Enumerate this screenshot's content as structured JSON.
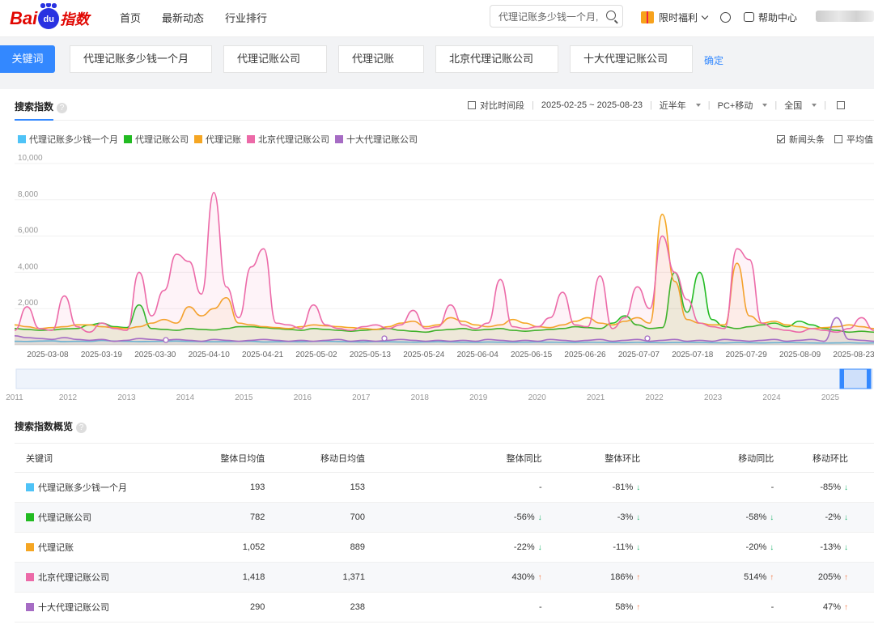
{
  "header": {
    "logo": {
      "bai": "Bai",
      "du": "du",
      "zhishu": "指数"
    },
    "nav": [
      "首页",
      "最新动态",
      "行业排行"
    ],
    "search_value": "代理记账多少钱一个月,",
    "welfare": "限时福利",
    "help": "帮助中心"
  },
  "keywords": {
    "label": "关键词",
    "items": [
      {
        "text": "代理记账多少钱一个月",
        "color": "#4fc3f7"
      },
      {
        "text": "代理记账公司",
        "color": "#22bb22"
      },
      {
        "text": "代理记账",
        "color": "#f5a623"
      },
      {
        "text": "北京代理记账公司",
        "color": "#ec6aa8"
      },
      {
        "text": "十大代理记账公司",
        "color": "#a66cc4"
      }
    ],
    "confirm": "确定"
  },
  "section": {
    "title": "搜索指数",
    "compare": "对比时间段",
    "date_range": "2025-02-25 ~ 2025-08-23",
    "period": "近半年",
    "device": "PC+移动",
    "region": "全国",
    "news": "新闻头条",
    "average": "平均值"
  },
  "chart_data": {
    "type": "line",
    "y_ticks": [
      "10,000",
      "8,000",
      "6,000",
      "4,000",
      "2,000"
    ],
    "ylim": [
      0,
      10000
    ],
    "x_ticks": [
      "2025-03-08",
      "2025-03-19",
      "2025-03-30",
      "2025-04-10",
      "2025-04-21",
      "2025-05-02",
      "2025-05-13",
      "2025-05-24",
      "2025-06-04",
      "2025-06-15",
      "2025-06-26",
      "2025-07-07",
      "2025-07-18",
      "2025-07-29",
      "2025-08-09",
      "2025-08-23"
    ],
    "series": [
      {
        "name": "代理记账多少钱一个月",
        "color": "#4fc3f7",
        "values": [
          200,
          190,
          210,
          220,
          180,
          200,
          190,
          240,
          210,
          200,
          180,
          190,
          200,
          210,
          190,
          180,
          170,
          180,
          190,
          200,
          160,
          170,
          180,
          170,
          190,
          200,
          180,
          170,
          160,
          180,
          170,
          160,
          150,
          160,
          170,
          160,
          150,
          140,
          160,
          150,
          140,
          150,
          160,
          150,
          140,
          130,
          150,
          140,
          130,
          120,
          140,
          130,
          120,
          130,
          140,
          130,
          120,
          110,
          130,
          120,
          110,
          120,
          130,
          120,
          110,
          100,
          110,
          120,
          100,
          110
        ]
      },
      {
        "name": "代理记账公司",
        "color": "#22bb22",
        "values": [
          900,
          850,
          800,
          820,
          880,
          900,
          1100,
          1200,
          1000,
          950,
          2200,
          900,
          850,
          800,
          900,
          850,
          820,
          900,
          1000,
          1000,
          950,
          900,
          850,
          800,
          900,
          850,
          800,
          750,
          800,
          850,
          900,
          800,
          750,
          700,
          800,
          850,
          900,
          800,
          850,
          900,
          800,
          750,
          800,
          850,
          900,
          1000,
          950,
          900,
          1200,
          1600,
          1100,
          900,
          950,
          4000,
          1800,
          4000,
          1400,
          1000,
          900,
          1000,
          1100,
          1200,
          1000,
          1300,
          1100,
          900,
          800,
          700,
          750,
          700
        ]
      },
      {
        "name": "代理记账",
        "color": "#f5a623",
        "values": [
          1100,
          1000,
          900,
          950,
          1000,
          1100,
          1100,
          1000,
          950,
          900,
          1000,
          1200,
          1400,
          1200,
          2100,
          1600,
          2000,
          2600,
          1200,
          1100,
          1000,
          950,
          900,
          1000,
          1100,
          1050,
          1000,
          950,
          900,
          850,
          1000,
          1200,
          1300,
          1000,
          1100,
          1500,
          1300,
          1100,
          1000,
          1100,
          1400,
          1200,
          1000,
          950,
          1100,
          1300,
          1500,
          1200,
          1100,
          1300,
          1500,
          1200,
          7200,
          3500,
          1400,
          1200,
          1100,
          1100,
          4500,
          1600,
          1200,
          1300,
          1100,
          1000,
          900,
          950,
          1000,
          1100,
          1000,
          900
        ]
      },
      {
        "name": "北京代理记账公司",
        "color": "#ec6aa8",
        "values": [
          800,
          2100,
          900,
          800,
          2700,
          1000,
          700,
          1200,
          900,
          800,
          4000,
          1600,
          3000,
          5000,
          4600,
          2800,
          8400,
          3200,
          1500,
          4300,
          5300,
          1200,
          1100,
          900,
          2200,
          1100,
          900,
          800,
          1000,
          1100,
          900,
          1100,
          1900,
          900,
          1000,
          2200,
          1100,
          900,
          1200,
          3600,
          1000,
          900,
          1000,
          1500,
          2900,
          1100,
          1000,
          3800,
          900,
          1500,
          3200,
          2000,
          6000,
          4000,
          2500,
          1200,
          1000,
          900,
          5300,
          4700,
          1200,
          900,
          800,
          700,
          900,
          800,
          700,
          900,
          1500,
          800
        ]
      },
      {
        "name": "十大代理记账公司",
        "color": "#a66cc4",
        "values": [
          500,
          400,
          350,
          300,
          400,
          300,
          250,
          300,
          200,
          250,
          350,
          300,
          250,
          300,
          250,
          200,
          300,
          250,
          200,
          250,
          300,
          250,
          200,
          250,
          200,
          250,
          300,
          200,
          250,
          200,
          250,
          300,
          250,
          200,
          250,
          200,
          250,
          200,
          300,
          250,
          200,
          250,
          200,
          300,
          250,
          200,
          250,
          300,
          200,
          250,
          300,
          200,
          250,
          300,
          200,
          250,
          200,
          300,
          250,
          200,
          250,
          300,
          200,
          250,
          300,
          200,
          1500,
          300,
          250,
          200
        ]
      }
    ],
    "navigator_years": [
      "2011",
      "2012",
      "2013",
      "2014",
      "2015",
      "2016",
      "2017",
      "2018",
      "2019",
      "2020",
      "2021",
      "2022",
      "2023",
      "2024",
      "2025"
    ]
  },
  "overview": {
    "title": "搜索指数概览",
    "columns": [
      "关键词",
      "整体日均值",
      "移动日均值",
      "整体同比",
      "整体环比",
      "移动同比",
      "移动环比"
    ],
    "rows": [
      {
        "kw": "代理记账多少钱一个月",
        "color": "#4fc3f7",
        "total_avg": "193",
        "mobile_avg": "153",
        "total_yoy": "-",
        "total_yoy_dir": "",
        "total_mom": "-81%",
        "total_mom_dir": "down",
        "mobile_yoy": "-",
        "mobile_yoy_dir": "",
        "mobile_mom": "-85%",
        "mobile_mom_dir": "down"
      },
      {
        "kw": "代理记账公司",
        "color": "#22bb22",
        "total_avg": "782",
        "mobile_avg": "700",
        "total_yoy": "-56%",
        "total_yoy_dir": "down",
        "total_mom": "-3%",
        "total_mom_dir": "down",
        "mobile_yoy": "-58%",
        "mobile_yoy_dir": "down",
        "mobile_mom": "-2%",
        "mobile_mom_dir": "down"
      },
      {
        "kw": "代理记账",
        "color": "#f5a623",
        "total_avg": "1,052",
        "mobile_avg": "889",
        "total_yoy": "-22%",
        "total_yoy_dir": "down",
        "total_mom": "-11%",
        "total_mom_dir": "down",
        "mobile_yoy": "-20%",
        "mobile_yoy_dir": "down",
        "mobile_mom": "-13%",
        "mobile_mom_dir": "down"
      },
      {
        "kw": "北京代理记账公司",
        "color": "#ec6aa8",
        "total_avg": "1,418",
        "mobile_avg": "1,371",
        "total_yoy": "430%",
        "total_yoy_dir": "up",
        "total_mom": "186%",
        "total_mom_dir": "up",
        "mobile_yoy": "514%",
        "mobile_yoy_dir": "up",
        "mobile_mom": "205%",
        "mobile_mom_dir": "up"
      },
      {
        "kw": "十大代理记账公司",
        "color": "#a66cc4",
        "total_avg": "290",
        "mobile_avg": "238",
        "total_yoy": "-",
        "total_yoy_dir": "",
        "total_mom": "58%",
        "total_mom_dir": "up",
        "mobile_yoy": "-",
        "mobile_yoy_dir": "",
        "mobile_mom": "47%",
        "mobile_mom_dir": "up"
      }
    ]
  }
}
